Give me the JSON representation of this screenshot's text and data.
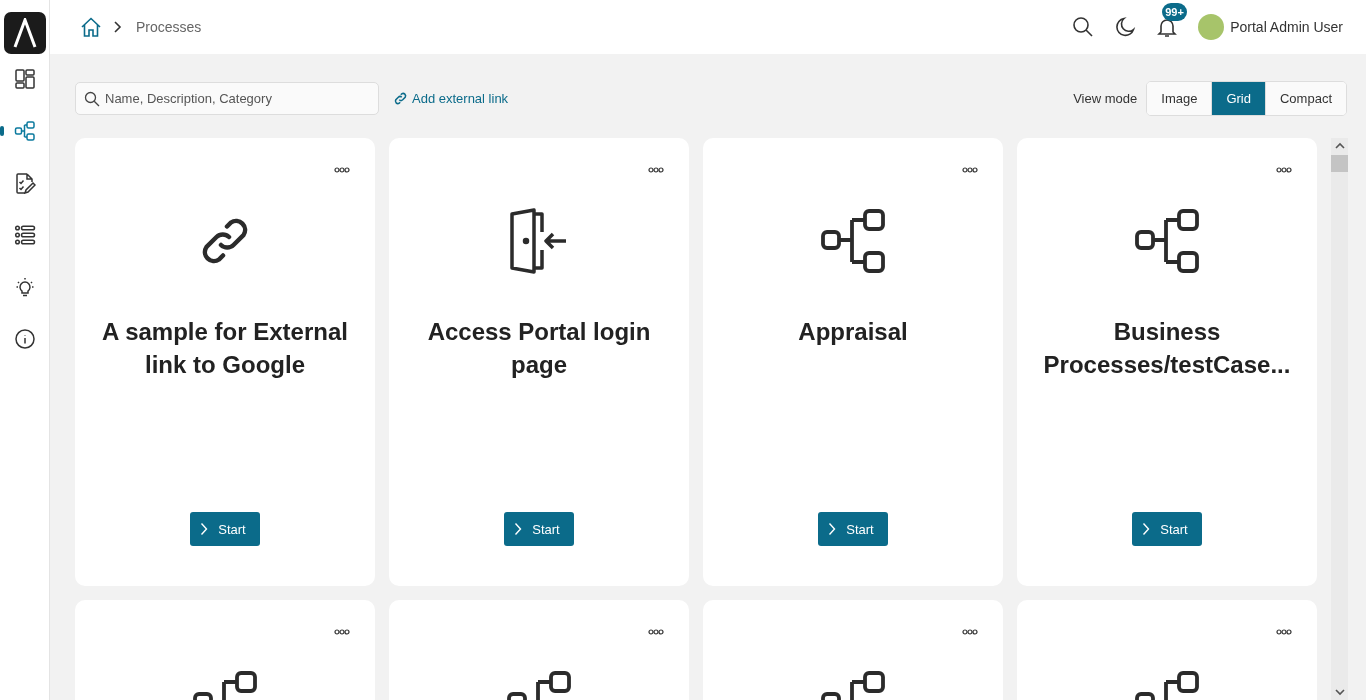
{
  "sidebar": {
    "items": [
      {
        "kind": "dashboard",
        "selected": false
      },
      {
        "kind": "process",
        "selected": true
      },
      {
        "kind": "task",
        "selected": false
      },
      {
        "kind": "list",
        "selected": false
      },
      {
        "kind": "bulb",
        "selected": false
      },
      {
        "kind": "info",
        "selected": false
      }
    ]
  },
  "breadcrumb": {
    "items": [
      "Processes"
    ]
  },
  "header": {
    "notification_badge": "99+",
    "user_name": "Portal Admin User"
  },
  "toolbar": {
    "search": {
      "placeholder": "Name, Description, Category"
    },
    "add_link": "Add external link",
    "view_mode_label": "View mode",
    "view_modes": [
      {
        "label": "Image",
        "selected": false
      },
      {
        "label": "Grid",
        "selected": true
      },
      {
        "label": "Compact",
        "selected": false
      }
    ]
  },
  "cards": [
    {
      "kind": "link",
      "title": "A sample for External link to Google",
      "button": "Start"
    },
    {
      "kind": "door",
      "title": "Access Portal login page",
      "button": "Start"
    },
    {
      "kind": "process",
      "title": "Appraisal",
      "button": "Start"
    },
    {
      "kind": "process",
      "title": "Business Processes/testCase...",
      "button": "Start"
    },
    {
      "kind": "process"
    },
    {
      "kind": "process"
    },
    {
      "kind": "process"
    },
    {
      "kind": "process"
    }
  ]
}
